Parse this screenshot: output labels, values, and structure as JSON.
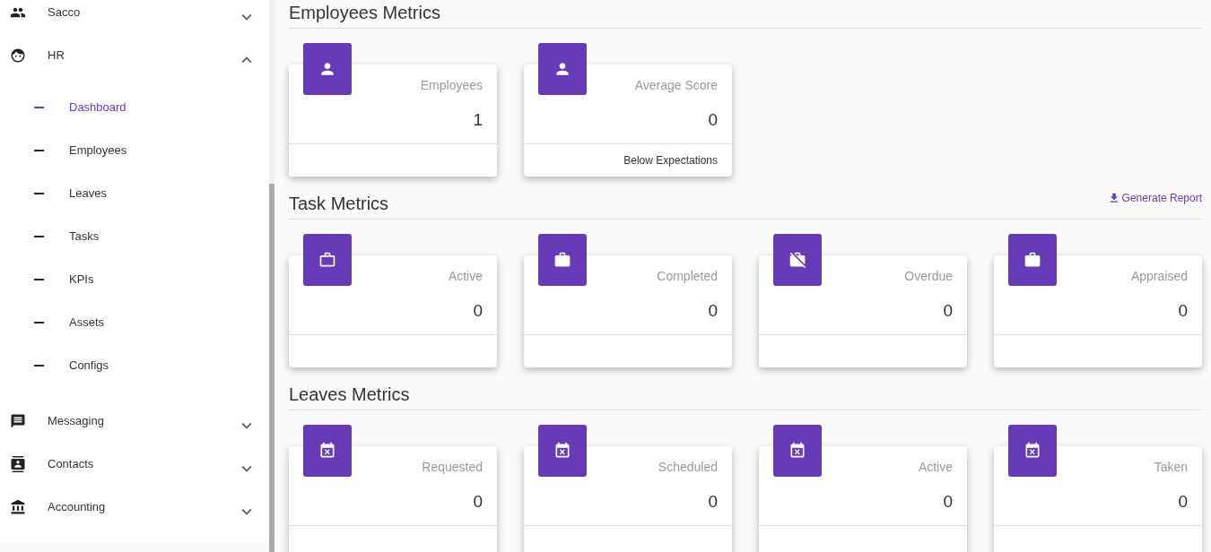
{
  "sidebar": {
    "items": [
      {
        "label": "Sacco",
        "kind": "people",
        "expanded": false
      },
      {
        "label": "HR",
        "kind": "face",
        "expanded": true,
        "children": [
          {
            "label": "Dashboard",
            "selected": true
          },
          {
            "label": "Employees",
            "selected": false
          },
          {
            "label": "Leaves",
            "selected": false
          },
          {
            "label": "Tasks",
            "selected": false
          },
          {
            "label": "KPIs",
            "selected": false
          },
          {
            "label": "Assets",
            "selected": false
          },
          {
            "label": "Configs",
            "selected": false
          }
        ]
      },
      {
        "label": "Messaging",
        "kind": "message",
        "expanded": false
      },
      {
        "label": "Contacts",
        "kind": "contacts",
        "expanded": false
      },
      {
        "label": "Accounting",
        "kind": "bank",
        "expanded": false
      }
    ]
  },
  "sections": [
    {
      "title": "Employees Metrics",
      "cards": [
        {
          "label": "Employees",
          "value": "1",
          "kind": "person"
        },
        {
          "label": "Average Score",
          "value": "0",
          "kind": "person",
          "footer": "Below Expectations"
        }
      ]
    },
    {
      "title": "Task Metrics",
      "action": "Generate Report",
      "cards": [
        {
          "label": "Active",
          "value": "0",
          "kind": "briefcase_outline"
        },
        {
          "label": "Completed",
          "value": "0",
          "kind": "briefcase"
        },
        {
          "label": "Overdue",
          "value": "0",
          "kind": "briefcase_off"
        },
        {
          "label": "Appraised",
          "value": "0",
          "kind": "briefcase"
        }
      ]
    },
    {
      "title": "Leaves Metrics",
      "cards": [
        {
          "label": "Requested",
          "value": "0",
          "kind": "calendar"
        },
        {
          "label": "Scheduled",
          "value": "0",
          "kind": "calendar"
        },
        {
          "label": "Active",
          "value": "0",
          "kind": "calendar"
        },
        {
          "label": "Taken",
          "value": "0",
          "kind": "calendar"
        }
      ]
    }
  ]
}
